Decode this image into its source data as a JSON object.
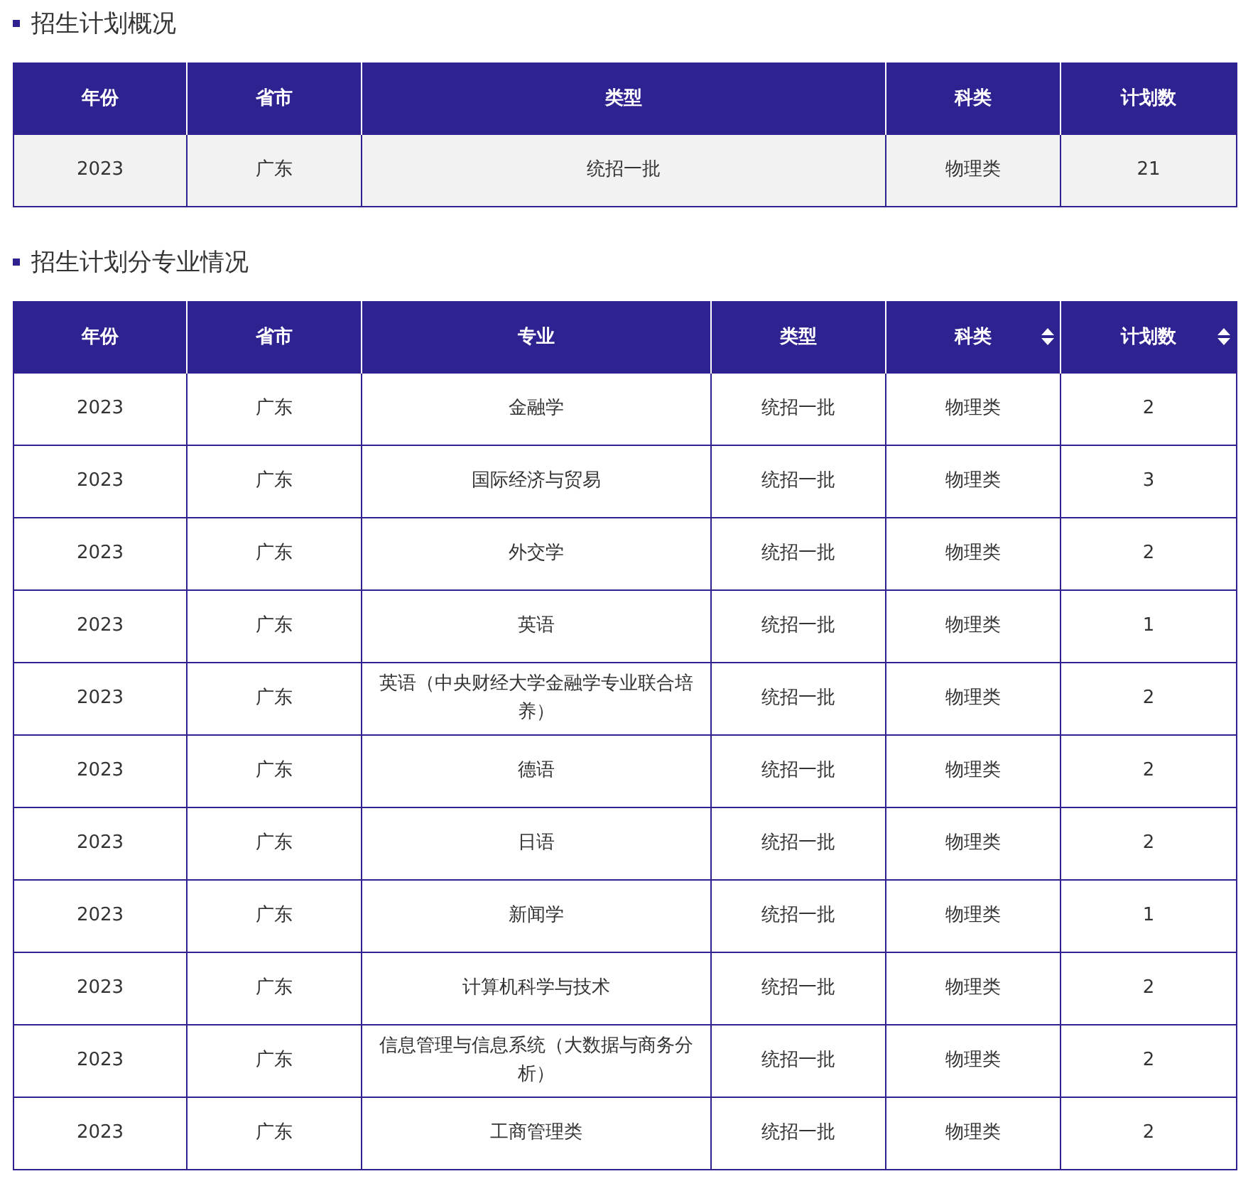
{
  "sections": [
    {
      "title": "招生计划概况",
      "table": {
        "columns": [
          {
            "label": "年份",
            "sortable": false
          },
          {
            "label": "省市",
            "sortable": false
          },
          {
            "label": "类型",
            "sortable": false
          },
          {
            "label": "科类",
            "sortable": false
          },
          {
            "label": "计划数",
            "sortable": false
          }
        ],
        "rows": [
          [
            "2023",
            "广东",
            "统招一批",
            "物理类",
            "21"
          ]
        ]
      }
    },
    {
      "title": "招生计划分专业情况",
      "table": {
        "columns": [
          {
            "label": "年份",
            "sortable": false
          },
          {
            "label": "省市",
            "sortable": false
          },
          {
            "label": "专业",
            "sortable": false
          },
          {
            "label": "类型",
            "sortable": false
          },
          {
            "label": "科类",
            "sortable": true
          },
          {
            "label": "计划数",
            "sortable": true
          }
        ],
        "rows": [
          [
            "2023",
            "广东",
            "金融学",
            "统招一批",
            "物理类",
            "2"
          ],
          [
            "2023",
            "广东",
            "国际经济与贸易",
            "统招一批",
            "物理类",
            "3"
          ],
          [
            "2023",
            "广东",
            "外交学",
            "统招一批",
            "物理类",
            "2"
          ],
          [
            "2023",
            "广东",
            "英语",
            "统招一批",
            "物理类",
            "1"
          ],
          [
            "2023",
            "广东",
            "英语（中央财经大学金融学专业联合培养）",
            "统招一批",
            "物理类",
            "2"
          ],
          [
            "2023",
            "广东",
            "德语",
            "统招一批",
            "物理类",
            "2"
          ],
          [
            "2023",
            "广东",
            "日语",
            "统招一批",
            "物理类",
            "2"
          ],
          [
            "2023",
            "广东",
            "新闻学",
            "统招一批",
            "物理类",
            "1"
          ],
          [
            "2023",
            "广东",
            "计算机科学与技术",
            "统招一批",
            "物理类",
            "2"
          ],
          [
            "2023",
            "广东",
            "信息管理与信息系统（大数据与商务分析）",
            "统招一批",
            "物理类",
            "2"
          ],
          [
            "2023",
            "广东",
            "工商管理类",
            "统招一批",
            "物理类",
            "2"
          ]
        ]
      }
    }
  ]
}
